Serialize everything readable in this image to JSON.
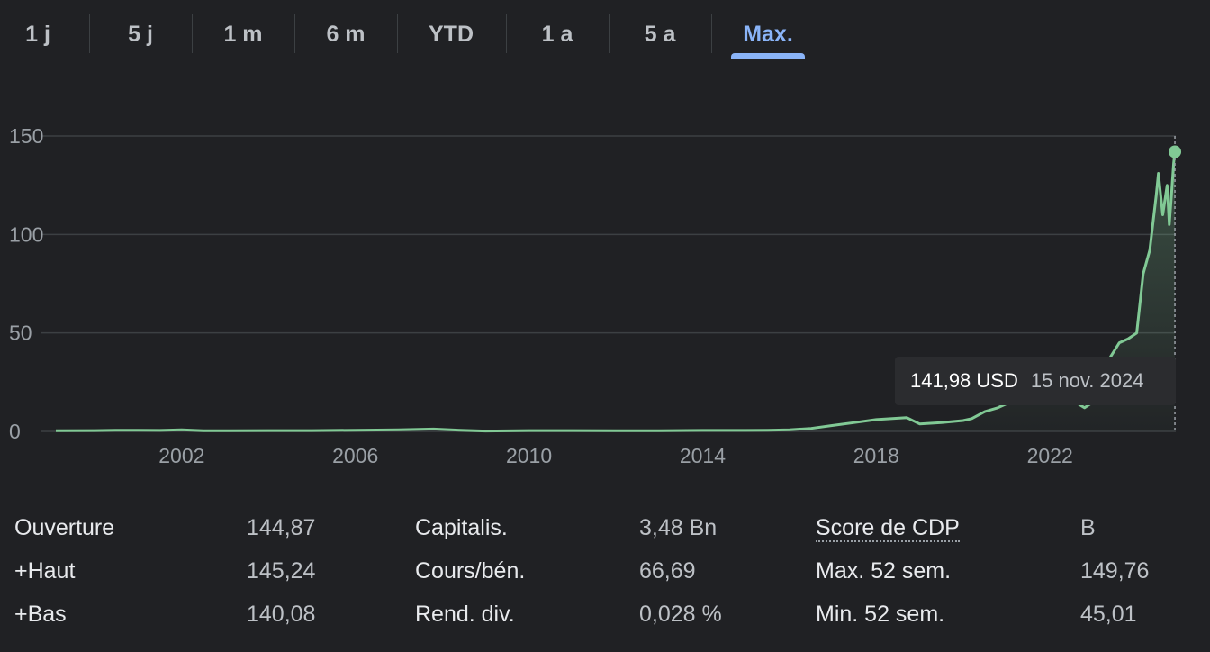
{
  "range_tabs": [
    {
      "label": "1 j",
      "active": false
    },
    {
      "label": "5 j",
      "active": false
    },
    {
      "label": "1 m",
      "active": false
    },
    {
      "label": "6 m",
      "active": false
    },
    {
      "label": "YTD",
      "active": false
    },
    {
      "label": "1 a",
      "active": false
    },
    {
      "label": "5 a",
      "active": false
    },
    {
      "label": "Max.",
      "active": true
    }
  ],
  "tooltip": {
    "value": "141,98 USD",
    "date": "15 nov. 2024"
  },
  "chart_data": {
    "type": "area",
    "title": "",
    "xlabel": "",
    "ylabel": "",
    "ylim": [
      0,
      150
    ],
    "xlim": [
      1999.1,
      2024.9
    ],
    "yticks": [
      {
        "value": 0,
        "label": "0"
      },
      {
        "value": 50,
        "label": "50"
      },
      {
        "value": 100,
        "label": "100"
      },
      {
        "value": 150,
        "label": "150"
      }
    ],
    "xticks": [
      {
        "value": 2002,
        "label": "2002"
      },
      {
        "value": 2006,
        "label": "2006"
      },
      {
        "value": 2010,
        "label": "2010"
      },
      {
        "value": 2014,
        "label": "2014"
      },
      {
        "value": 2018,
        "label": "2018"
      },
      {
        "value": 2022,
        "label": "2022"
      }
    ],
    "grid": true,
    "colors": {
      "line": "#81c995",
      "grid": "#3c4043",
      "marker": "#81c995"
    },
    "series": [
      {
        "x": [
          1999.1,
          2000.0,
          2000.5,
          2001.0,
          2001.5,
          2002.0,
          2002.5,
          2003.0,
          2004.0,
          2005.0,
          2006.0,
          2007.0,
          2007.8,
          2008.5,
          2009.0,
          2010.0,
          2011.0,
          2012.0,
          2013.0,
          2014.0,
          2015.0,
          2015.5,
          2016.0,
          2016.5,
          2017.0,
          2017.5,
          2018.0,
          2018.7,
          2019.0,
          2019.5,
          2020.0,
          2020.2,
          2020.5,
          2020.8,
          2021.0,
          2021.5,
          2021.9,
          2022.0,
          2022.5,
          2022.8,
          2023.0,
          2023.2,
          2023.4,
          2023.6,
          2023.8,
          2024.0,
          2024.15,
          2024.3,
          2024.45,
          2024.5,
          2024.6,
          2024.7,
          2024.75,
          2024.8,
          2024.85,
          2024.88
        ],
        "y": [
          0.3,
          0.4,
          0.6,
          0.6,
          0.5,
          0.8,
          0.3,
          0.3,
          0.4,
          0.4,
          0.6,
          0.8,
          1.2,
          0.5,
          0.2,
          0.4,
          0.4,
          0.3,
          0.3,
          0.5,
          0.5,
          0.6,
          0.8,
          1.5,
          3.0,
          4.5,
          6.0,
          7.0,
          3.8,
          4.5,
          5.5,
          6.5,
          10.0,
          12.0,
          14.0,
          19.0,
          30.0,
          25.0,
          16.0,
          12.0,
          15.0,
          26.0,
          38.0,
          45.0,
          47.0,
          50.0,
          80.0,
          92.0,
          120.0,
          131.0,
          110.0,
          125.0,
          105.0,
          120.0,
          136.0,
          141.98
        ]
      }
    ],
    "marker": {
      "x": 2024.88,
      "y": 141.98
    }
  },
  "stats": [
    {
      "label": "Ouverture",
      "value": "144,87"
    },
    {
      "label": "+Haut",
      "value": "145,24"
    },
    {
      "label": "+Bas",
      "value": "140,08"
    },
    {
      "label": "Capitalis.",
      "value": "3,48 Bn"
    },
    {
      "label": "Cours/bén.",
      "value": "66,69"
    },
    {
      "label": "Rend. div.",
      "value": "0,028 %"
    },
    {
      "label": "Score de CDP",
      "value": "B"
    },
    {
      "label": "Max. 52 sem.",
      "value": "149,76"
    },
    {
      "label": "Min. 52 sem.",
      "value": "45,01"
    }
  ]
}
